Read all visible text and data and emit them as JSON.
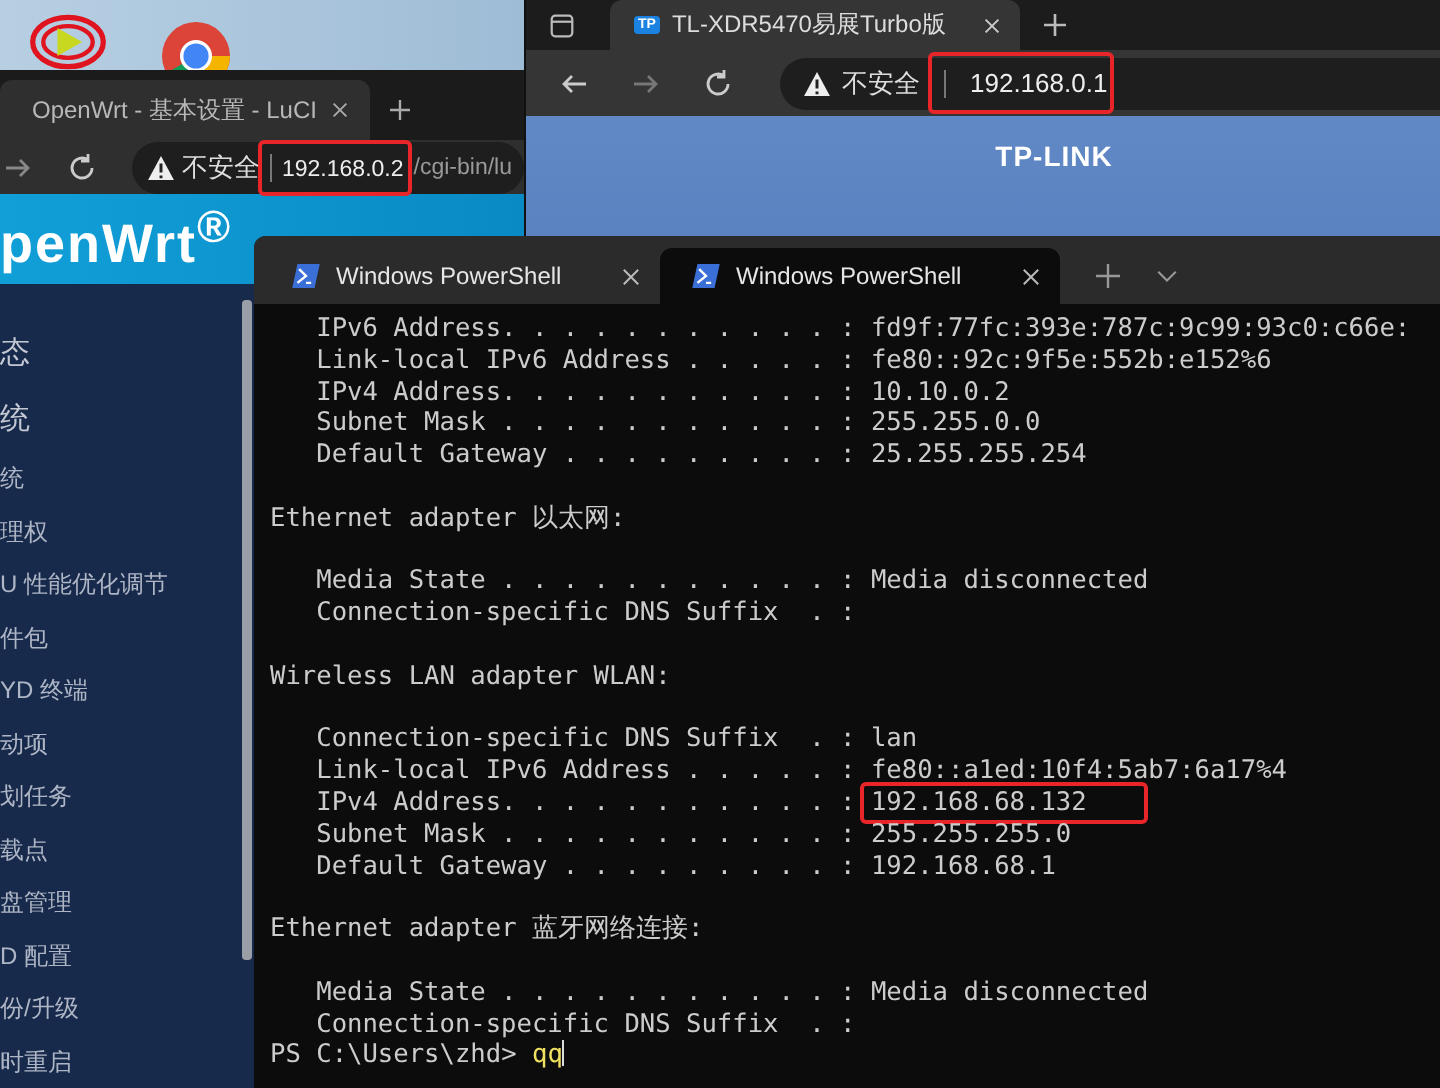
{
  "openwrt_browser": {
    "tab_title": "OpenWrt - 基本设置 - LuCI",
    "security_label": "不安全",
    "url_host": "192.168.0.2",
    "url_path": "/cgi-bin/lu",
    "url_highlighted": true,
    "brand": "penWrt$^{®}$",
    "sidebar": {
      "items": [
        {
          "label": "态",
          "kind": "section"
        },
        {
          "label": "统",
          "kind": "section"
        },
        {
          "label": "统",
          "kind": "item"
        },
        {
          "label": "理权",
          "kind": "item"
        },
        {
          "label": "U 性能优化调节",
          "kind": "item"
        },
        {
          "label": "件包",
          "kind": "item"
        },
        {
          "label": "YD 终端",
          "kind": "item"
        },
        {
          "label": "动项",
          "kind": "item"
        },
        {
          "label": "划任务",
          "kind": "item"
        },
        {
          "label": "载点",
          "kind": "item"
        },
        {
          "label": "盘管理",
          "kind": "item"
        },
        {
          "label": "D 配置",
          "kind": "item"
        },
        {
          "label": "份/升级",
          "kind": "item"
        },
        {
          "label": "时重启",
          "kind": "item"
        }
      ]
    }
  },
  "tplink_browser": {
    "tab_title": "TL-XDR5470易展Turbo版",
    "favicon": "TP",
    "security_label": "不安全",
    "url_host": "192.168.0.1",
    "url_highlighted": true,
    "logo": "TP-LINK"
  },
  "terminal": {
    "tabs": [
      {
        "title": "Windows PowerShell",
        "selected": false
      },
      {
        "title": "Windows PowerShell",
        "selected": true
      }
    ],
    "blocks": [
      {
        "kind": "entries",
        "lines": [
          {
            "label": "IPv6 Address. . . . . . . . . . . :",
            "value": "fd9f:77fc:393e:787c:9c99:93c0:c66e:",
            "highlighted": false
          },
          {
            "label": "Link-local IPv6 Address . . . . . :",
            "value": "fe80::92c:9f5e:552b:e152%6",
            "highlighted": false
          },
          {
            "label": "IPv4 Address. . . . . . . . . . . :",
            "value": "10.10.0.2",
            "highlighted": false
          },
          {
            "label": "Subnet Mask . . . . . . . . . . . :",
            "value": "255.255.0.0",
            "highlighted": false
          },
          {
            "label": "Default Gateway . . . . . . . . . :",
            "value": "25.255.255.254",
            "highlighted": false
          }
        ]
      },
      {
        "kind": "heading",
        "text": "Ethernet adapter 以太网:"
      },
      {
        "kind": "entries",
        "lines": [
          {
            "label": "Media State . . . . . . . . . . . :",
            "value": "Media disconnected",
            "highlighted": false
          },
          {
            "label": "Connection-specific DNS Suffix  . :",
            "highlighted": false
          }
        ]
      },
      {
        "kind": "heading",
        "text": "Wireless LAN adapter WLAN:"
      },
      {
        "kind": "entries",
        "lines": [
          {
            "label": "Connection-specific DNS Suffix  . :",
            "value": "lan",
            "highlighted": false
          },
          {
            "label": "Link-local IPv6 Address . . . . . :",
            "value": "fe80::a1ed:10f4:5ab7:6a17%4",
            "highlighted": false
          },
          {
            "label": "IPv4 Address. . . . . . . . . . . :",
            "value": "192.168.68.132",
            "highlighted": true
          },
          {
            "label": "Subnet Mask . . . . . . . . . . . :",
            "value": "255.255.255.0",
            "highlighted": false
          },
          {
            "label": "Default Gateway . . . . . . . . . :",
            "value": "192.168.68.1",
            "highlighted": false
          }
        ]
      },
      {
        "kind": "heading",
        "text": "Ethernet adapter 蓝牙网络连接:"
      },
      {
        "kind": "entries",
        "lines": [
          {
            "label": "Media State . . . . . . . . . . . :",
            "value": "Media disconnected",
            "highlighted": false
          },
          {
            "label": "Connection-specific DNS Suffix  . :",
            "highlighted": false
          }
        ]
      }
    ],
    "prompt": "PS C:\\Users\\zhd>",
    "input": "qq"
  }
}
